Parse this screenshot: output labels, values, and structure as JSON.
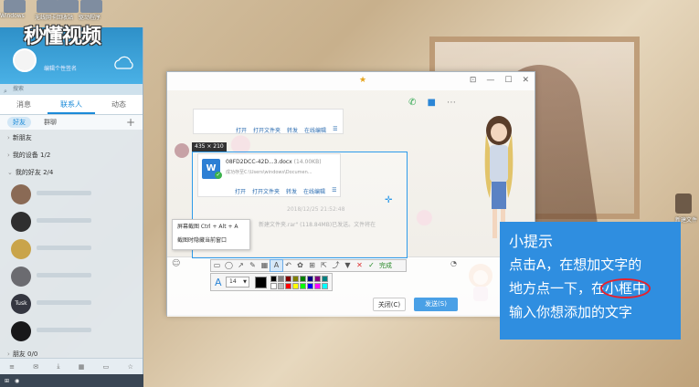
{
  "watermark": "秒懂视频",
  "desktop": {
    "icons": [
      {
        "label": "Windows"
      },
      {
        "label": "无线网卡"
      },
      {
        "label": "回收站"
      },
      {
        "label": "驱动程序"
      }
    ],
    "right_item_label": "新建文件"
  },
  "qq": {
    "signature": "编辑个性签名",
    "search_placeholder": "搜索",
    "tabs": [
      {
        "label": "消息",
        "active": false
      },
      {
        "label": "联系人",
        "active": true
      },
      {
        "label": "动态",
        "active": false
      }
    ],
    "subtabs": [
      {
        "label": "好友",
        "active": true
      },
      {
        "label": "群聊",
        "active": false
      }
    ],
    "groups": {
      "new_friends": "新朋友",
      "my_devices": "我的设备  1/2",
      "my_friends": "我的好友  2/4",
      "friends": "朋友  0/0"
    },
    "friend_avatar_text": "Tusk"
  },
  "chat": {
    "msg1_actions": [
      "打开",
      "打开文件夹",
      "转发",
      "在线编辑"
    ],
    "time": "2018/12/25  21:52:48",
    "file_line": "新建文件夹.rar\"  (118.84MB)已发送。文件将在",
    "close_button": "关闭(C)",
    "send_button": "发送(S)"
  },
  "screenshot": {
    "size_label": "435 × 210",
    "file": {
      "icon_letter": "W",
      "name": "08FD2DCC-42D...3.docx",
      "size": "(14.00KB)",
      "path": "成功存至C:\\Users\\windows\\Documen..."
    },
    "file_actions": [
      "打开",
      "打开文件夹",
      "转发",
      "在线编辑"
    ],
    "context_menu": [
      "屏幕截图 Ctrl + Alt + A",
      "截图时隐藏当前窗口"
    ],
    "done_label": "完成",
    "font_size": "14",
    "palette": [
      "#000000",
      "#808080",
      "#800000",
      "#808000",
      "#008000",
      "#000080",
      "#800080",
      "#008080",
      "#ffffff",
      "#c0c0c0",
      "#ff0000",
      "#ffff00",
      "#00ff00",
      "#0000ff",
      "#ff00ff",
      "#00ffff"
    ]
  },
  "tip": {
    "title": "小提示",
    "line1": "点击A，在想加文字的",
    "line2_pre": "地方点一下，在",
    "line2_hl": "小框中",
    "line3": "输入你想添加的文字"
  },
  "colors": {
    "tip_bg": "#2f8ee0",
    "highlight_ring": "#e8202b",
    "selection": "#2e9bea"
  }
}
